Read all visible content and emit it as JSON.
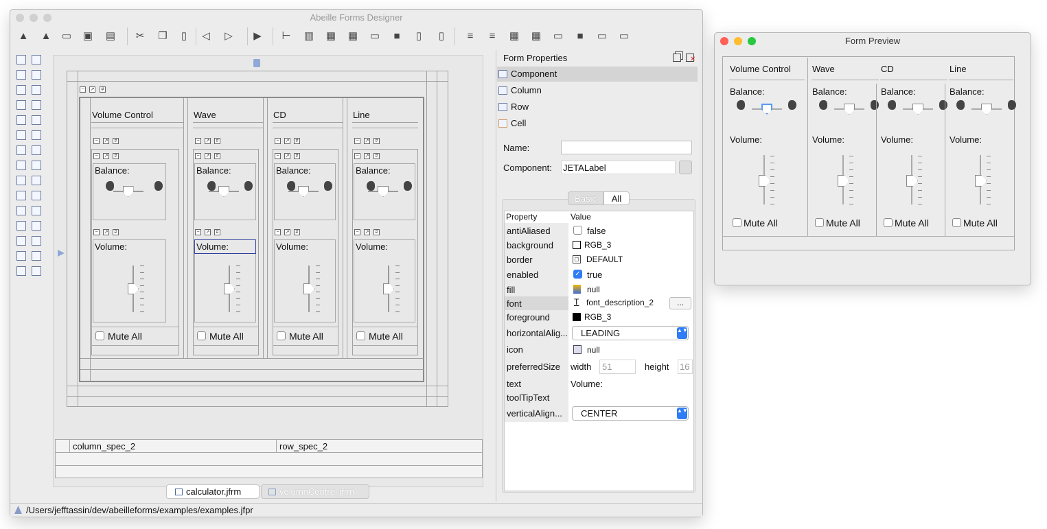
{
  "designer": {
    "title": "Abeille Forms Designer",
    "status_path": "/Users/jefftassin/dev/abeilleforms/examples/examples.jfpr",
    "tabs": [
      {
        "label": "calculator.jfrm"
      },
      {
        "label": "volumnControl.jfrm"
      }
    ],
    "spec_fields": {
      "column": "column_spec_2",
      "row": "row_spec_2"
    },
    "canvas": {
      "columns": [
        {
          "header": "Volume Control",
          "balance": "Balance:",
          "volume": "Volume:",
          "mute": "Mute All"
        },
        {
          "header": "Wave",
          "balance": "Balance:",
          "volume": "Volume:",
          "mute": "Mute All"
        },
        {
          "header": "CD",
          "balance": "Balance:",
          "volume": "Volume:",
          "mute": "Mute All"
        },
        {
          "header": "Line",
          "balance": "Balance:",
          "volume": "Volume:",
          "mute": "Mute All"
        }
      ]
    }
  },
  "properties": {
    "title": "Form Properties",
    "tree": [
      {
        "label": "Component"
      },
      {
        "label": "Column"
      },
      {
        "label": "Row"
      },
      {
        "label": "Cell"
      }
    ],
    "name_label": "Name:",
    "name_value": "",
    "component_label": "Component:",
    "component_value": "JETALabel",
    "tabs": {
      "basic": "Basic",
      "all": "All"
    },
    "col_property": "Property",
    "col_value": "Value",
    "rows": [
      {
        "key": "antiAliased",
        "value": "false"
      },
      {
        "key": "background",
        "value": "RGB_3"
      },
      {
        "key": "border",
        "value": "DEFAULT"
      },
      {
        "key": "enabled",
        "value": "true"
      },
      {
        "key": "fill",
        "value": "null"
      },
      {
        "key": "font",
        "value": "font_description_2"
      },
      {
        "key": "foreground",
        "value": "RGB_3"
      },
      {
        "key": "horizontalAlig...",
        "value": "LEADING"
      },
      {
        "key": "icon",
        "value": "null"
      },
      {
        "key": "preferredSize",
        "value": ""
      },
      {
        "key": "text",
        "value": "Volume:"
      },
      {
        "key": "toolTipText",
        "value": ""
      },
      {
        "key": "verticalAlign...",
        "value": "CENTER"
      }
    ],
    "pref_width_label": "width",
    "pref_width": "51",
    "pref_height_label": "height",
    "pref_height": "16",
    "ellipsis": "..."
  },
  "preview": {
    "title": "Form Preview",
    "columns": [
      {
        "header": "Volume Control",
        "balance": "Balance:",
        "volume": "Volume:",
        "mute": "Mute All"
      },
      {
        "header": "Wave",
        "balance": "Balance:",
        "volume": "Volume:",
        "mute": "Mute All"
      },
      {
        "header": "CD",
        "balance": "Balance:",
        "volume": "Volume:",
        "mute": "Mute All"
      },
      {
        "header": "Line",
        "balance": "Balance:",
        "volume": "Volume:",
        "mute": "Mute All"
      }
    ]
  },
  "colors": {
    "accent": "#2f7cf6",
    "close": "#fe5f57",
    "minimize": "#febc2e",
    "zoom": "#28c840"
  }
}
